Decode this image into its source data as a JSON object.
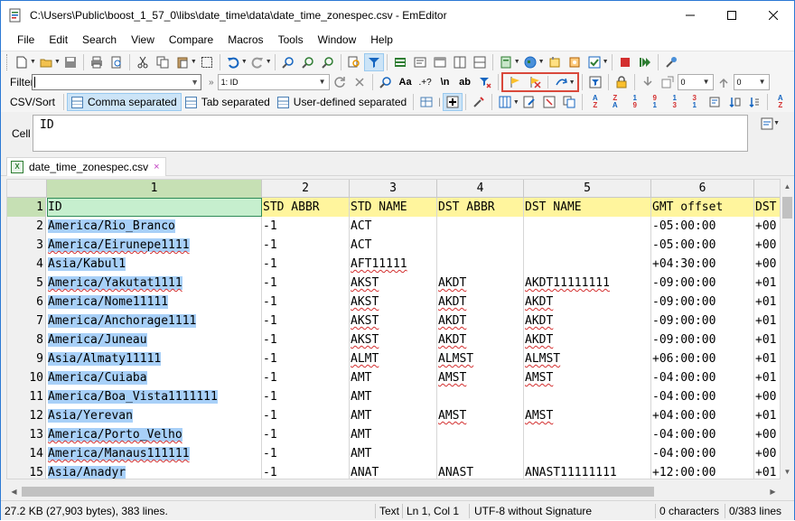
{
  "window": {
    "title": "C:\\Users\\Public\\boost_1_57_0\\libs\\date_time\\data\\date_time_zonespec.csv - EmEditor"
  },
  "menu": [
    "File",
    "Edit",
    "Search",
    "View",
    "Compare",
    "Macros",
    "Tools",
    "Window",
    "Help"
  ],
  "filter_bar": {
    "label": "Filter",
    "value": "",
    "column_combo": "1: ID",
    "num_combo_1": "0",
    "num_combo_2": "0"
  },
  "csv_bar": {
    "label": "CSV/Sort",
    "comma": "Comma separated",
    "tab": "Tab separated",
    "user": "User-defined separated"
  },
  "cell_bar": {
    "label": "Cell",
    "value": "ID"
  },
  "tab": {
    "name": "date_time_zonespec.csv",
    "close": "×"
  },
  "grid": {
    "column_headers": [
      "1",
      "2",
      "3",
      "4",
      "5",
      "6"
    ],
    "rows": [
      {
        "n": "1",
        "c": [
          "ID",
          "STD ABBR",
          "STD NAME",
          "DST ABBR",
          "DST NAME",
          "GMT offset",
          "DST"
        ]
      },
      {
        "n": "2",
        "c": [
          "America/Rio_Branco",
          "-1",
          "ACT",
          "",
          "",
          "-05:00:00",
          "+00"
        ]
      },
      {
        "n": "3",
        "c": [
          "America/Eirunepe1111",
          "-1",
          "ACT",
          "",
          "",
          "-05:00:00",
          "+00"
        ]
      },
      {
        "n": "4",
        "c": [
          "Asia/Kabul1",
          "-1",
          "AFT11111",
          "",
          "",
          "+04:30:00",
          "+00"
        ]
      },
      {
        "n": "5",
        "c": [
          "America/Yakutat1111",
          "-1",
          "AKST",
          "AKDT",
          "AKDT11111111",
          "-09:00:00",
          "+01"
        ]
      },
      {
        "n": "6",
        "c": [
          "America/Nome11111",
          "-1",
          "AKST",
          "AKDT",
          "AKDT",
          "-09:00:00",
          "+01"
        ]
      },
      {
        "n": "7",
        "c": [
          "America/Anchorage1111",
          "-1",
          "AKST",
          "AKDT",
          "AKDT",
          "-09:00:00",
          "+01"
        ]
      },
      {
        "n": "8",
        "c": [
          "America/Juneau",
          "-1",
          "AKST",
          "AKDT",
          "AKDT",
          "-09:00:00",
          "+01"
        ]
      },
      {
        "n": "9",
        "c": [
          "Asia/Almaty11111",
          "-1",
          "ALMT",
          "ALMST",
          "ALMST",
          "+06:00:00",
          "+01"
        ]
      },
      {
        "n": "10",
        "c": [
          "America/Cuiaba",
          "-1",
          "AMT",
          "AMST",
          "AMST",
          "-04:00:00",
          "+01"
        ]
      },
      {
        "n": "11",
        "c": [
          "America/Boa_Vista1111111",
          "-1",
          "AMT",
          "",
          "",
          "-04:00:00",
          "+00"
        ]
      },
      {
        "n": "12",
        "c": [
          "Asia/Yerevan",
          "-1",
          "AMT",
          "AMST",
          "AMST",
          "+04:00:00",
          "+01"
        ]
      },
      {
        "n": "13",
        "c": [
          "America/Porto_Velho",
          "-1",
          "AMT",
          "",
          "",
          "-04:00:00",
          "+00"
        ]
      },
      {
        "n": "14",
        "c": [
          "America/Manaus111111",
          "-1",
          "AMT",
          "",
          "",
          "-04:00:00",
          "+00"
        ]
      },
      {
        "n": "15",
        "c": [
          "Asia/Anadyr",
          "-1",
          "ANAT",
          "ANAST",
          "ANAST11111111",
          "+12:00:00",
          "+01"
        ]
      }
    ]
  },
  "status": {
    "size": "27.2 KB (27,903 bytes), 383 lines.",
    "mode": "Text",
    "pos": "Ln 1, Col 1",
    "encoding": "UTF-8 without Signature",
    "chars": "0 characters",
    "lines": "0/383 lines"
  },
  "colors": {
    "header_row": "#fff59d",
    "selection": "#a8d0f8",
    "active_cell": "#c6efce",
    "highlight_box": "#d9483b"
  }
}
